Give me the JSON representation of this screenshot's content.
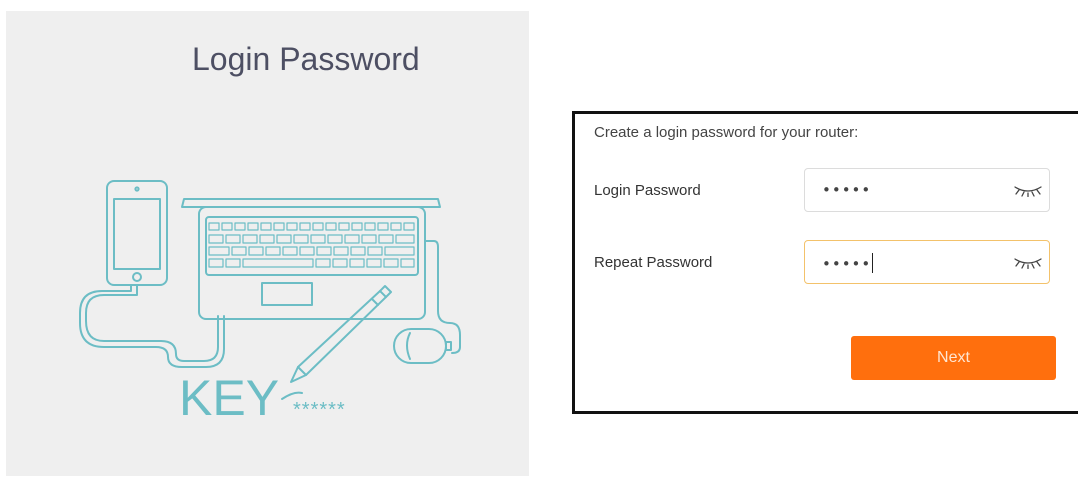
{
  "header": {
    "title": "Login Password"
  },
  "illustration": {
    "key_text": "KEY",
    "asterisks": "******",
    "stroke_color": "#6cbdc5"
  },
  "form": {
    "intro": "Create a login password for your router:",
    "fields": [
      {
        "label": "Login Password",
        "value": "•••••",
        "icon": "eye-closed-icon",
        "focused": false
      },
      {
        "label": "Repeat Password",
        "value": "•••••",
        "icon": "eye-closed-icon",
        "focused": true
      }
    ],
    "next_label": "Next"
  },
  "colors": {
    "accent": "#ff6f0d",
    "panel_bg": "#efefef",
    "focus_border": "#f3c26b"
  }
}
